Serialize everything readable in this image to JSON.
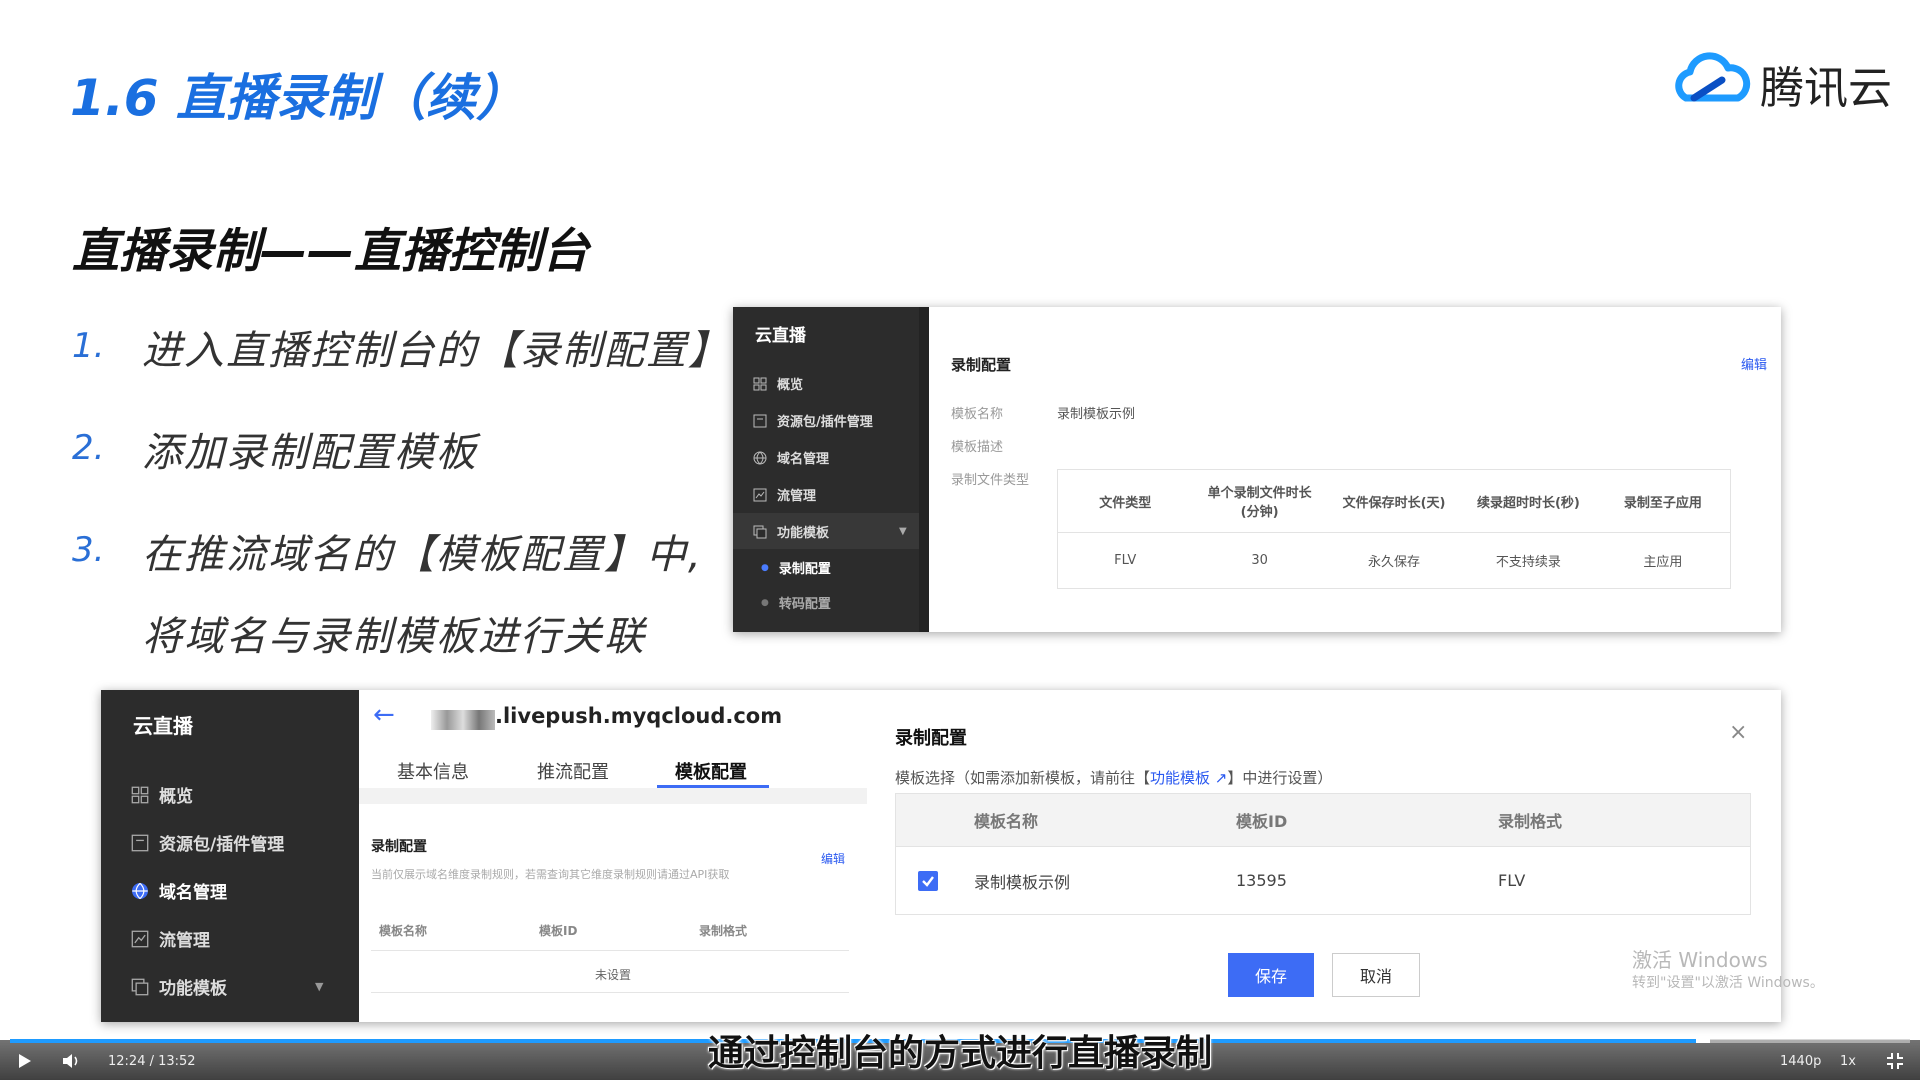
{
  "slide": {
    "title": "1.6 直播录制（续）",
    "logo_text": "腾讯云",
    "section_title": "直播录制——直播控制台",
    "steps": [
      {
        "num": "1.",
        "text": "进入直播控制台的【录制配置】"
      },
      {
        "num": "2.",
        "text": "添加录制配置模板"
      },
      {
        "num": "3.",
        "text": "在推流域名的【模板配置】中,",
        "text2": "将域名与录制模板进行关联"
      }
    ]
  },
  "top_screenshot": {
    "brand": "云直播",
    "nav": [
      {
        "label": "概览",
        "icon": "grid-icon"
      },
      {
        "label": "资源包/插件管理",
        "icon": "package-icon"
      },
      {
        "label": "域名管理",
        "icon": "globe-icon"
      },
      {
        "label": "流管理",
        "icon": "chart-icon"
      },
      {
        "label": "功能模板",
        "icon": "copy-icon"
      },
      {
        "label": "录制配置"
      },
      {
        "label": "转码配置"
      }
    ],
    "heading": "录制配置",
    "edit": "编辑",
    "template_name_label": "模板名称",
    "template_name_value": "录制模板示例",
    "template_desc_label": "模板描述",
    "file_type_label": "录制文件类型",
    "table_headers": [
      "文件类型",
      "单个录制文件时长\n(分钟)",
      "文件保存时长(天)",
      "续录超时时长(秒)",
      "录制至子应用"
    ],
    "table_row": [
      "FLV",
      "30",
      "永久保存",
      "不支持续录",
      "主应用"
    ]
  },
  "bottom_screenshot": {
    "brand": "云直播",
    "nav": [
      {
        "label": "概览",
        "icon": "grid-icon"
      },
      {
        "label": "资源包/插件管理",
        "icon": "package-icon"
      },
      {
        "label": "域名管理",
        "icon": "globe-icon"
      },
      {
        "label": "流管理",
        "icon": "chart-icon"
      },
      {
        "label": "功能模板",
        "icon": "copy-icon"
      }
    ],
    "domain": ".livepush.myqcloud.com",
    "tabs": [
      "基本信息",
      "推流配置",
      "模板配置"
    ],
    "record_heading": "录制配置",
    "record_note": "当前仅展示域名维度录制规则，若需查询其它维度录制规则请通过API获取",
    "record_edit": "编辑",
    "mini_headers": [
      "模板名称",
      "模板ID",
      "录制格式"
    ],
    "mini_empty": "未设置",
    "dialog": {
      "title": "录制配置",
      "hint_prefix": "模板选择（如需添加新模板，请前往【",
      "hint_link": "功能模板",
      "hint_suffix": "】中进行设置）",
      "headers": [
        "模板名称",
        "模板ID",
        "录制格式"
      ],
      "row": {
        "name": "录制模板示例",
        "id": "13595",
        "format": "FLV",
        "checked": true
      },
      "save": "保存",
      "cancel": "取消"
    }
  },
  "watermark": {
    "line1": "激活 Windows",
    "line2": "转到\"设置\"以激活 Windows。"
  },
  "player": {
    "subtitle": "通过控制台的方式进行直播录制",
    "time": "12:24 / 13:52",
    "progress": 0.893,
    "quality": "1440p",
    "speed": "1x"
  },
  "colors": {
    "title_blue": "#1a6fe0",
    "accent": "#2a59f0",
    "sidebar_dark": "#2c2c2c",
    "progress": "#1e9bff"
  }
}
